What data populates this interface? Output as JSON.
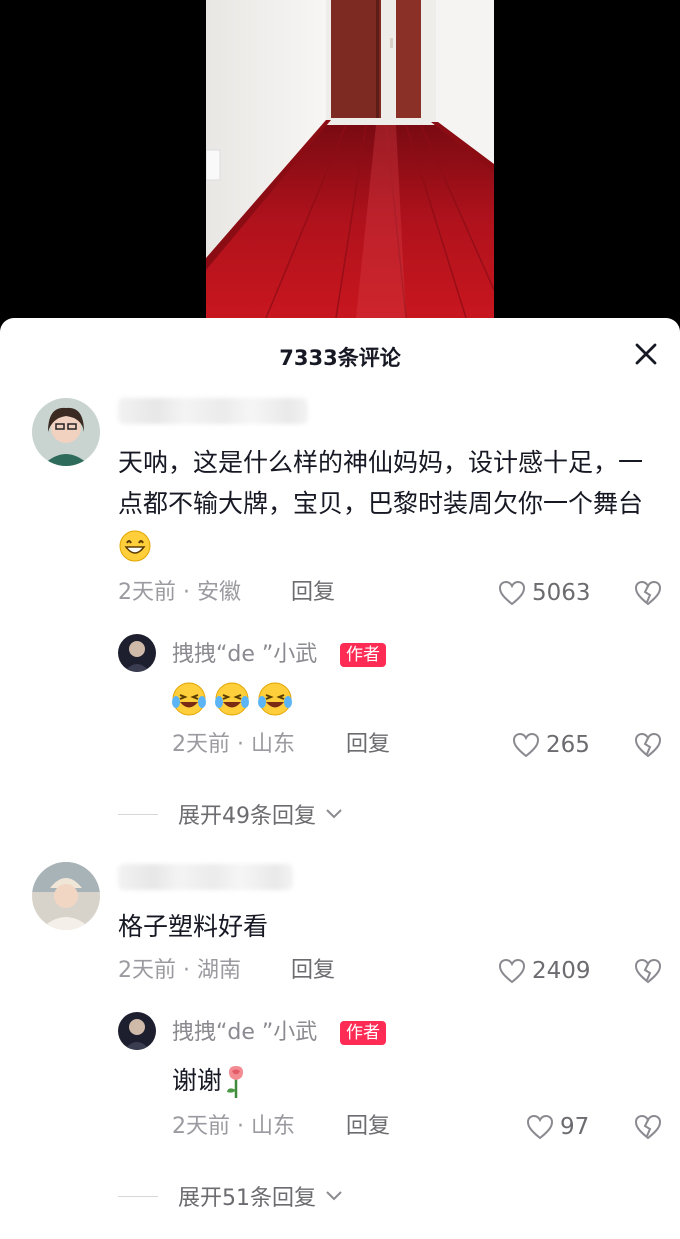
{
  "panel": {
    "title": "7333条评论"
  },
  "comments": [
    {
      "text": "天呐，这是什么样的神仙妈妈，设计感十足，一点都不输大牌，宝贝，巴黎时装周欠你一个舞台",
      "time": "2天前",
      "location": "安徽",
      "reply_label": "回复",
      "likes": "5063",
      "reply": {
        "author": "拽拽“de ”小武",
        "badge": "作者",
        "time": "2天前",
        "location": "山东",
        "reply_label": "回复",
        "likes": "265"
      },
      "expand_label": "展开49条回复"
    },
    {
      "text": "格子塑料好看",
      "time": "2天前",
      "location": "湖南",
      "reply_label": "回复",
      "likes": "2409",
      "reply": {
        "author": "拽拽“de ”小武",
        "badge": "作者",
        "text": "谢谢",
        "time": "2天前",
        "location": "山东",
        "reply_label": "回复",
        "likes": "97"
      },
      "expand_label": "展开51条回复"
    }
  ],
  "meta_separator": "·",
  "colors": {
    "accent": "#fe2c55",
    "floor": "#a3141e"
  },
  "icons": [
    "close-icon",
    "heart-icon",
    "broken-heart-icon",
    "chevron-down-icon",
    "grin-emoji-icon",
    "laugh-cry-emoji-icon",
    "rose-emoji-icon"
  ]
}
